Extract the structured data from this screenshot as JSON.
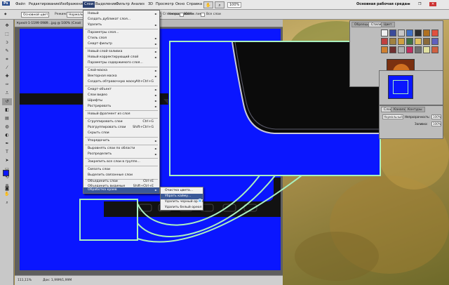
{
  "menubar": {
    "items": [
      "Файл",
      "Редактирование",
      "Изображение",
      "Слои",
      "Выделение",
      "Фильтр",
      "Анализ",
      "3D",
      "Просмотр",
      "Окно",
      "Справка"
    ],
    "active": "Слои",
    "zoom": "100%",
    "workspace_label": "Основная рабочая среда"
  },
  "options_bar": {
    "mode_value": "Основной цвет",
    "mode_label": "Режим:",
    "mode_select": "Нормальный",
    "opacity_label": "Непрозрачн.:",
    "opacity_value": "100%",
    "options": [
      "Сглаживание",
      "Смеж.пикс.",
      "Все слои"
    ]
  },
  "document": {
    "tab_title": "pexit-1-1199 0989...jpg @ 100% (Слой",
    "status_zoom": "111,11%",
    "status_doc": "Док: 1,99М/1,99М"
  },
  "layers_menu": {
    "items": [
      {
        "label": "Новый",
        "arrow": "►"
      },
      {
        "label": "Создать дубликат слоя..."
      },
      {
        "label": "Удалить",
        "arrow": "►",
        "sep_after": true
      },
      {
        "label": "Параметры слоя..."
      },
      {
        "label": "Стиль слоя",
        "arrow": "►"
      },
      {
        "label": "Смарт-фильтр",
        "arrow": "►",
        "sep_after": true
      },
      {
        "label": "Новый слой-заливка",
        "arrow": "►"
      },
      {
        "label": "Новый корректирующий слой",
        "arrow": "►"
      },
      {
        "label": "Параметры содержимого слоя...",
        "sep_after": true
      },
      {
        "label": "Слой-маска",
        "arrow": "►"
      },
      {
        "label": "Векторная маска",
        "arrow": "►"
      },
      {
        "label": "Создать обтравочную маску",
        "shortcut": "Alt+Ctrl+G",
        "sep_after": true
      },
      {
        "label": "Смарт-объект",
        "arrow": "►"
      },
      {
        "label": "Слои видео",
        "arrow": "►"
      },
      {
        "label": "Шрифты",
        "arrow": "►"
      },
      {
        "label": "Растрировать",
        "arrow": "►",
        "sep_after": true
      },
      {
        "label": "Новый фрагмент из слоя",
        "sep_after": true
      },
      {
        "label": "Сгруппировать слои",
        "shortcut": "Ctrl+G"
      },
      {
        "label": "Разгруппировать слои",
        "shortcut": "Shift+Ctrl+G"
      },
      {
        "label": "Скрыть слои",
        "sep_after": true
      },
      {
        "label": "Упорядочить",
        "arrow": "►",
        "sep_after": true
      },
      {
        "label": "Выровнять слои по области",
        "arrow": "►"
      },
      {
        "label": "Распределить",
        "arrow": "►",
        "sep_after": true
      },
      {
        "label": "Закрепить все слои в группе...",
        "sep_after": true
      },
      {
        "label": "Связать слои"
      },
      {
        "label": "Выделить связанные слои",
        "sep_after": true
      },
      {
        "label": "Объединить слои",
        "shortcut": "Ctrl+E"
      },
      {
        "label": "Объединить видимые",
        "shortcut": "Shift+Ctrl+E"
      },
      {
        "label": "Выполнить сведение",
        "sep_after": true
      },
      {
        "label": "Обработка краев",
        "arrow": "►",
        "highlighted": true
      }
    ]
  },
  "submenu": {
    "items": [
      "Очистка цвета...",
      "Убрать кайму...",
      "Удалить черный ореол",
      "Удалить белый ореол"
    ],
    "highlighted_index": 1
  },
  "panels": {
    "swatches_tabs": [
      "Образцы",
      "Стили",
      "Цвет"
    ],
    "layers_tabs": [
      "Слои",
      "Каналы",
      "Контуры"
    ],
    "blend_mode": "Нормальный",
    "opacity_label": "Непрозрачность:",
    "opacity_value": "100%",
    "fill_label": "Заливка:",
    "fill_value": "100%"
  },
  "colors": {
    "canvas_blue": "#0a16ff",
    "callout_green": "#aaf0c0",
    "menu_highlight": "#3b5998"
  }
}
